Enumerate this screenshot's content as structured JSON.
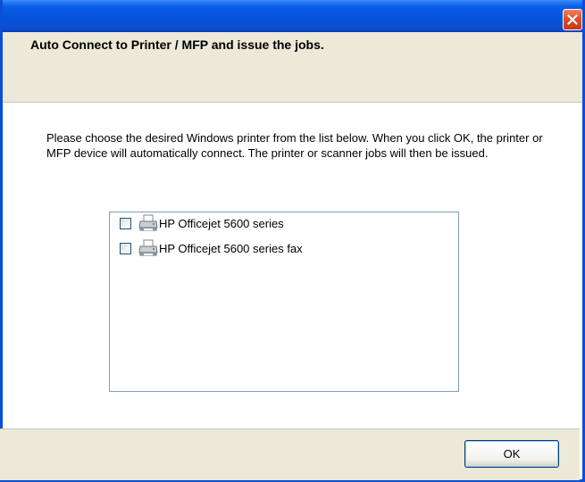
{
  "window": {
    "close_label": ""
  },
  "header": {
    "title": "Auto Connect to Printer / MFP and issue the jobs."
  },
  "instructions": {
    "text": "Please choose the desired Windows printer from the list below. When you click OK, the printer or MFP device will automatically connect. The printer or scanner jobs will then be issued."
  },
  "printer_list": {
    "items": [
      {
        "label": "HP Officejet 5600 series",
        "checked": false,
        "icon": "printer-icon"
      },
      {
        "label": "HP Officejet 5600 series fax",
        "checked": false,
        "icon": "printer-icon"
      }
    ]
  },
  "footer": {
    "ok_label": "OK"
  },
  "colors": {
    "titlebar": "#0553dc",
    "band": "#ece9d8",
    "close_button": "#e04a22",
    "listbox_border": "#7f9db9"
  }
}
